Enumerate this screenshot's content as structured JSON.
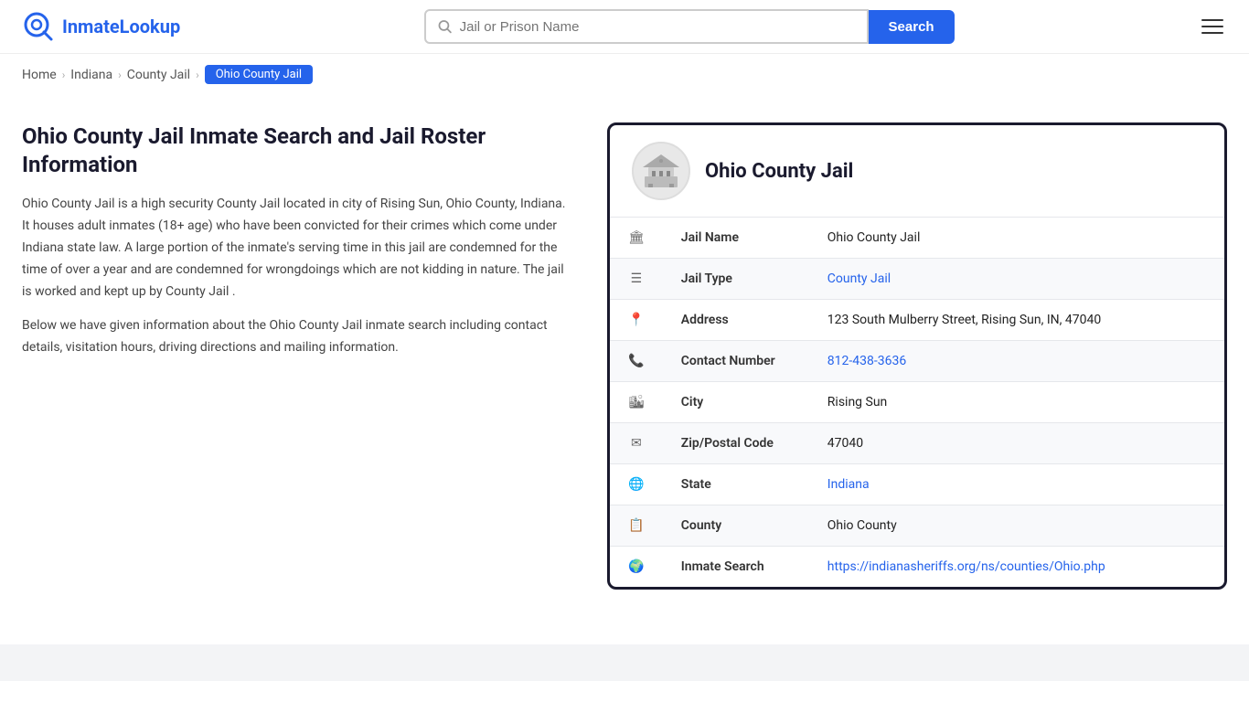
{
  "header": {
    "logo_text_part1": "Inmate",
    "logo_text_part2": "Lookup",
    "search_placeholder": "Jail or Prison Name",
    "search_button_label": "Search"
  },
  "breadcrumb": {
    "items": [
      {
        "label": "Home",
        "href": "#"
      },
      {
        "label": "Indiana",
        "href": "#"
      },
      {
        "label": "County Jail",
        "href": "#"
      },
      {
        "label": "Ohio County Jail",
        "current": true
      }
    ]
  },
  "left": {
    "heading": "Ohio County Jail Inmate Search and Jail Roster Information",
    "para1": "Ohio County Jail is a high security County Jail located in city of Rising Sun, Ohio County, Indiana. It houses adult inmates (18+ age) who have been convicted for their crimes which come under Indiana state law. A large portion of the inmate's serving time in this jail are condemned for the time of over a year and are condemned for wrongdoings which are not kidding in nature. The jail is worked and kept up by County Jail .",
    "para2": "Below we have given information about the Ohio County Jail inmate search including contact details, visitation hours, driving directions and mailing information."
  },
  "card": {
    "title": "Ohio County Jail",
    "rows": [
      {
        "icon": "🏛",
        "label": "Jail Name",
        "value": "Ohio County Jail",
        "link": null
      },
      {
        "icon": "☰",
        "label": "Jail Type",
        "value": "County Jail",
        "link": "#"
      },
      {
        "icon": "📍",
        "label": "Address",
        "value": "123 South Mulberry Street, Rising Sun, IN, 47040",
        "link": null
      },
      {
        "icon": "📞",
        "label": "Contact Number",
        "value": "812-438-3636",
        "link": "tel:8124383636"
      },
      {
        "icon": "🏙",
        "label": "City",
        "value": "Rising Sun",
        "link": null
      },
      {
        "icon": "✉",
        "label": "Zip/Postal Code",
        "value": "47040",
        "link": null
      },
      {
        "icon": "🌐",
        "label": "State",
        "value": "Indiana",
        "link": "#"
      },
      {
        "icon": "📋",
        "label": "County",
        "value": "Ohio County",
        "link": null
      },
      {
        "icon": "🌍",
        "label": "Inmate Search",
        "value": "https://indianasheriffs.org/ns/counties/Ohio.php",
        "link": "https://indianasheriffs.org/ns/counties/Ohio.php"
      }
    ]
  }
}
